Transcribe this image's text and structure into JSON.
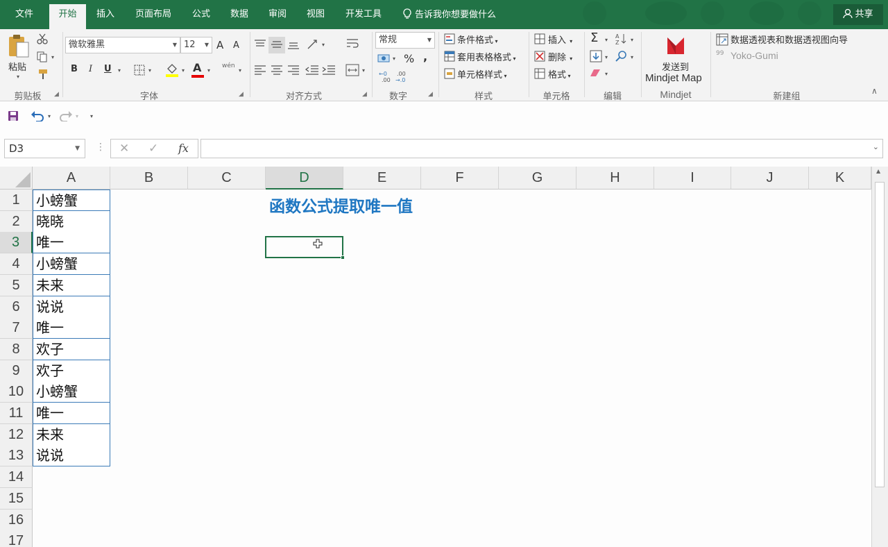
{
  "tabs": [
    {
      "label": "文件",
      "active": false
    },
    {
      "label": "开始",
      "active": true
    },
    {
      "label": "插入",
      "active": false
    },
    {
      "label": "页面布局",
      "active": false
    },
    {
      "label": "公式",
      "active": false
    },
    {
      "label": "数据",
      "active": false
    },
    {
      "label": "审阅",
      "active": false
    },
    {
      "label": "视图",
      "active": false
    },
    {
      "label": "开发工具",
      "active": false
    }
  ],
  "tell_me": "告诉我你想要做什么",
  "share": "共享",
  "ribbon": {
    "clipboard": {
      "paste": "粘贴",
      "label": "剪贴板"
    },
    "font": {
      "name": "微软雅黑",
      "size": "12",
      "bold": "B",
      "italic": "I",
      "underline": "U",
      "grow": "A",
      "shrink": "A",
      "color_a": "A",
      "phonetic": "wén",
      "label": "字体"
    },
    "alignment": {
      "label": "对齐方式"
    },
    "number": {
      "format": "常规",
      "percent": "%",
      "comma": ",",
      "label": "数字"
    },
    "styles": {
      "conditional": "条件格式",
      "table": "套用表格格式",
      "cell": "单元格样式",
      "label": "样式"
    },
    "cells": {
      "insert": "插入",
      "delete": "删除",
      "format": "格式",
      "label": "单元格"
    },
    "editing": {
      "label": "编辑"
    },
    "mindjet": {
      "send_line1": "发送到",
      "send_line2": "Mindjet Map",
      "label": "Mindjet"
    },
    "newgroup": {
      "pivot": "数据透视表和数据透视图向导",
      "yoko": "Yoko-Gumi",
      "label": "新建组"
    }
  },
  "formula_bar": {
    "name_box": "D3",
    "cancel": "✕",
    "enter": "✓",
    "fx": "fx",
    "value": ""
  },
  "columns": [
    "A",
    "B",
    "C",
    "D",
    "E",
    "F",
    "G",
    "H",
    "I",
    "J",
    "K"
  ],
  "selected_column": "D",
  "rows": [
    "1",
    "2",
    "3",
    "4",
    "5",
    "6",
    "7",
    "8",
    "9",
    "10",
    "11",
    "12",
    "13",
    "14",
    "15",
    "16",
    "17"
  ],
  "selected_row": "3",
  "column_a_values": [
    "小螃蟹",
    "晓晓",
    "唯一",
    "小螃蟹",
    "未来",
    "说说",
    "唯一",
    "欢子",
    "欢子",
    "小螃蟹",
    "唯一",
    "未来",
    "说说"
  ],
  "title_cell": "函数公式提取唯一值",
  "colors": {
    "accent": "#217346",
    "title": "#1f77c2",
    "border": "#3a7ab7"
  }
}
